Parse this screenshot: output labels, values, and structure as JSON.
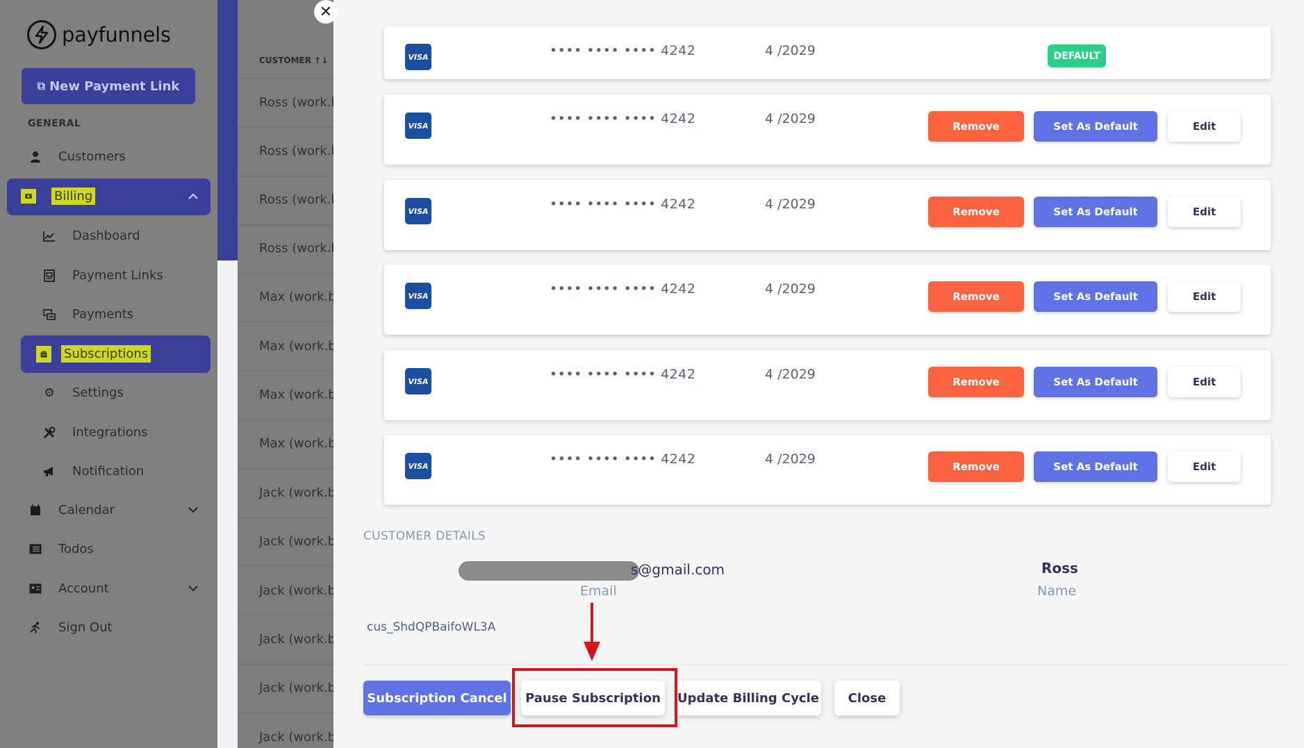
{
  "app": {
    "logo_text": "payfunnels"
  },
  "sidebar": {
    "new_link_label": "New Payment Link",
    "section_general": "GENERAL",
    "items": [
      {
        "label": "Customers",
        "icon": "user-icon"
      },
      {
        "label": "Billing",
        "icon": "money-icon"
      },
      {
        "label": "Dashboard",
        "icon": "chart-icon"
      },
      {
        "label": "Payment Links",
        "icon": "link-icon"
      },
      {
        "label": "Payments",
        "icon": "payments-icon"
      },
      {
        "label": "Subscriptions",
        "icon": "subscriptions-icon"
      },
      {
        "label": "Settings",
        "icon": "gear-icon"
      },
      {
        "label": "Integrations",
        "icon": "tools-icon"
      },
      {
        "label": "Notification",
        "icon": "megaphone-icon"
      },
      {
        "label": "Calendar",
        "icon": "calendar-icon"
      },
      {
        "label": "Todos",
        "icon": "list-icon"
      },
      {
        "label": "Account",
        "icon": "id-card-icon"
      },
      {
        "label": "Sign Out",
        "icon": "runner-icon"
      }
    ]
  },
  "list": {
    "header": "CUSTOMER ↑↓",
    "rows": [
      "Ross (work.bh",
      "Ross (work.bh",
      "Ross (work.bh",
      "Ross (work.bh",
      "Max (work.bh",
      "Max (work.bh",
      "Max (work.bh",
      "Max (work.bh",
      "Jack (work.bh",
      "Jack (work.bh",
      "Jack (work.bh",
      "Jack (work.bh",
      "Jack (work.bh",
      "Jack (work.bh"
    ]
  },
  "modal": {
    "cards": [
      {
        "brand": "VISA",
        "masked": "•••• •••• •••• 4242",
        "expiry": "4 /2029",
        "badge": "DEFAULT"
      },
      {
        "brand": "VISA",
        "masked": "•••• •••• •••• 4242",
        "expiry": "4 /2029",
        "remove": "Remove",
        "set_default": "Set As Default",
        "edit": "Edit"
      },
      {
        "brand": "VISA",
        "masked": "•••• •••• •••• 4242",
        "expiry": "4 /2029",
        "remove": "Remove",
        "set_default": "Set As Default",
        "edit": "Edit"
      },
      {
        "brand": "VISA",
        "masked": "•••• •••• •••• 4242",
        "expiry": "4 /2029",
        "remove": "Remove",
        "set_default": "Set As Default",
        "edit": "Edit"
      },
      {
        "brand": "VISA",
        "masked": "•••• •••• •••• 4242",
        "expiry": "4 /2029",
        "remove": "Remove",
        "set_default": "Set As Default",
        "edit": "Edit"
      },
      {
        "brand": "VISA",
        "masked": "•••• •••• •••• 4242",
        "expiry": "4 /2029",
        "remove": "Remove",
        "set_default": "Set As Default",
        "edit": "Edit"
      }
    ],
    "customer_details": {
      "title": "CUSTOMER DETAILS",
      "email_value": "s@gmail.com",
      "email_label": "Email",
      "name_value": "Ross",
      "name_label": "Name",
      "customer_id": "cus_ShdQPBaifoWL3A"
    },
    "footer": {
      "cancel_label": "Subscription Cancel",
      "pause_label": "Pause Subscription",
      "update_label": "Update Billing Cycle",
      "close_label": "Close"
    }
  },
  "colors": {
    "brand": "#3a3f9a",
    "primary": "#5e72e4",
    "danger": "#fb6340",
    "success": "#2dce89",
    "highlight": "#cfd623",
    "annotation": "#d9141a"
  }
}
